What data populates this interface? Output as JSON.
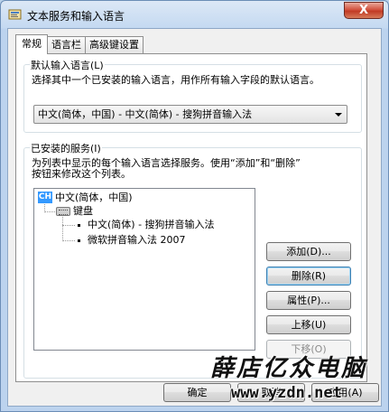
{
  "window": {
    "title": "文本服务和输入语言",
    "close_glyph": "X"
  },
  "tabs": [
    {
      "label": "常规",
      "active": true
    },
    {
      "label": "语言栏",
      "active": false
    },
    {
      "label": "高级键设置",
      "active": false
    }
  ],
  "default_language": {
    "group_label": "默认输入语言(L)",
    "description": "选择其中一个已安装的输入语言，用作所有输入字段的默认语言。",
    "selected": "中文(简体，中国) - 中文(简体) - 搜狗拼音输入法"
  },
  "installed_services": {
    "group_label": "已安装的服务(I)",
    "description_line1": "为列表中显示的每个输入语言选择服务。使用“添加”和“删除”",
    "description_line2": "按钮来修改这个列表。",
    "tree": {
      "language_badge": "CH",
      "language": "中文(简体，中国)",
      "category": "键盘",
      "items": [
        "中文(简体) - 搜狗拼音输入法",
        "微软拼音输入法 2007"
      ]
    },
    "buttons": {
      "add": "添加(D)...",
      "remove": "删除(R)",
      "properties": "属性(P)...",
      "move_up": "上移(U)",
      "move_down": "下移(O)"
    }
  },
  "footer": {
    "ok": "确定",
    "cancel": "取消",
    "apply": "应用(A)"
  },
  "watermark": {
    "text": "薛店亿众电脑",
    "url": "www.yzdn.net"
  },
  "colors": {
    "selection": "#3399ff",
    "close": "#c13a24"
  }
}
